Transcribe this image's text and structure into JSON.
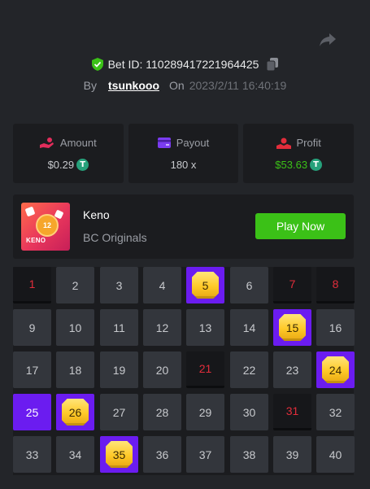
{
  "bet": {
    "id_label": "Bet ID: 110289417221964425",
    "by_label": "By",
    "username": "tsunkooo",
    "on_label": "On",
    "date": "2023/2/11 16:40:19"
  },
  "stats": {
    "amount": {
      "label": "Amount",
      "value": "$0.29",
      "icon": "hand-coins-icon"
    },
    "payout": {
      "label": "Payout",
      "value": "180 x",
      "icon": "wallet-icon"
    },
    "profit": {
      "label": "Profit",
      "value": "$53.63",
      "icon": "hand-profit-icon"
    }
  },
  "coin_symbol": "T",
  "game": {
    "name": "Keno",
    "provider": "BC Originals",
    "play_label": "Play Now",
    "thumb_label": "KENO",
    "thumb_ball": "12"
  },
  "colors": {
    "accent": "#3bc117",
    "hit": "#6b1cf0",
    "miss": "#e22d3b",
    "gem": "#ffc928"
  },
  "grid": {
    "numbers": [
      "1",
      "2",
      "3",
      "4",
      "5",
      "6",
      "7",
      "8",
      "9",
      "10",
      "11",
      "12",
      "13",
      "14",
      "15",
      "16",
      "17",
      "18",
      "19",
      "20",
      "21",
      "22",
      "23",
      "24",
      "25",
      "26",
      "27",
      "28",
      "29",
      "30",
      "31",
      "32",
      "33",
      "34",
      "35",
      "36",
      "37",
      "38",
      "39",
      "40"
    ],
    "hits": [
      "5",
      "15",
      "24",
      "26",
      "35"
    ],
    "drawn_only": [
      "25"
    ],
    "misses": [
      "1",
      "7",
      "8",
      "21",
      "31"
    ]
  }
}
